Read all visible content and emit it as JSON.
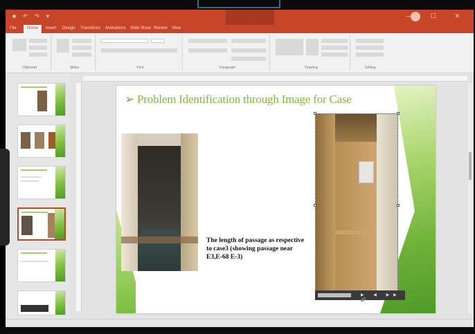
{
  "app": {
    "title": "",
    "user_name": "",
    "window_controls": "— ☐ ✕"
  },
  "ribbon": {
    "tabs": [
      "File",
      "Home",
      "Insert",
      "Design",
      "Transitions",
      "Animations",
      "Slide Show",
      "Review",
      "View"
    ],
    "active_tab_index": 1,
    "groups": [
      "Clipboard",
      "Slides",
      "Font",
      "Paragraph",
      "Drawing",
      "Editing"
    ]
  },
  "slide": {
    "title_bullet": "➢",
    "title": "Problem Identification through Image for Case",
    "caption": "The length of passage as respective to case3 (showing passage near E3,E-68 E-3)"
  },
  "thumbnails": {
    "numbers": [
      "2",
      "3",
      "4",
      "5",
      "6",
      "7"
    ],
    "selected_index": 3
  },
  "statusbar": {
    "left": "",
    "right": ""
  },
  "colors": {
    "titlebar": "#c9452a",
    "slide_title": "#7fba3a",
    "slide_green": "#6fb23a"
  },
  "icons": {
    "media_controls": "▶ ◀ ▶▶ 🔊"
  }
}
